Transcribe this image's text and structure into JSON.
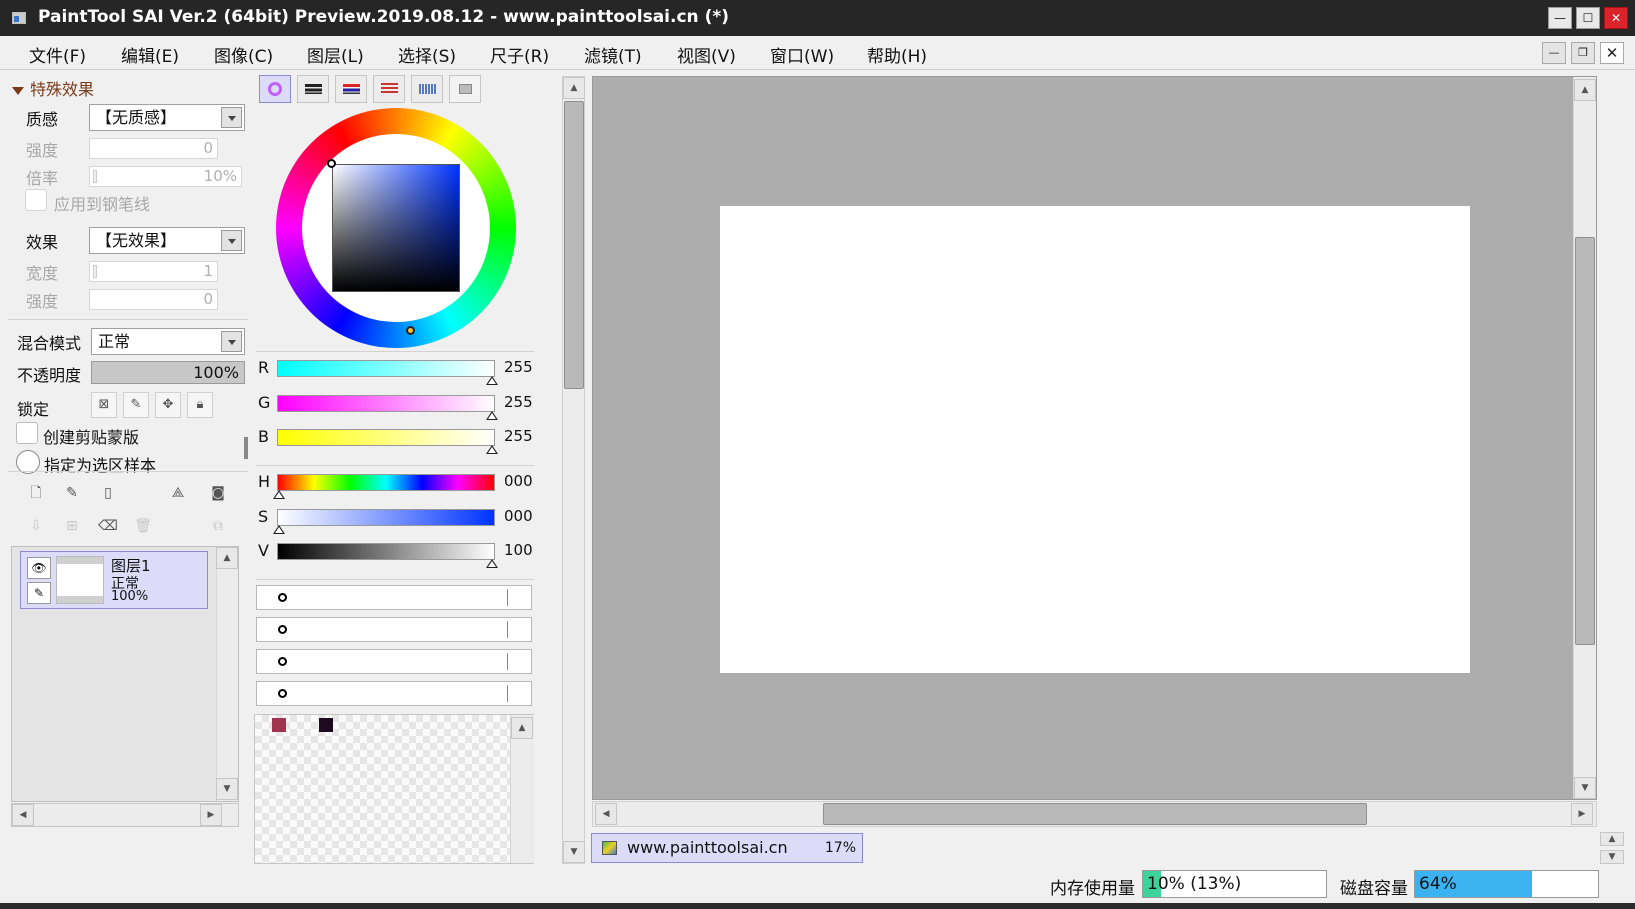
{
  "window": {
    "title": "PaintTool SAI Ver.2 (64bit) Preview.2019.08.12 - www.painttoolsai.cn (*)",
    "minimize": "—",
    "maximize": "☐",
    "close": "✕"
  },
  "menu": {
    "items": [
      "文件(F)",
      "编辑(E)",
      "图像(C)",
      "图层(L)",
      "选择(S)",
      "尺子(R)",
      "滤镜(T)",
      "视图(V)",
      "窗口(W)",
      "帮助(H)"
    ],
    "min": "—",
    "restore": "❐",
    "close": "✕"
  },
  "layer_props": {
    "section_title": "特殊效果",
    "texture_label": "质感",
    "texture_value": "【无质感】",
    "strength_label": "强度",
    "strength_value": "0",
    "rate_label": "倍率",
    "rate_value": "10%",
    "apply_pen_label": "应用到钢笔线",
    "effect_label": "效果",
    "effect_value": "【无效果】",
    "width_label": "宽度",
    "width_value": "1",
    "effect_strength_label": "强度",
    "effect_strength_value": "0",
    "blend_label": "混合模式",
    "blend_value": "正常",
    "opacity_label": "不透明度",
    "opacity_value": "100%",
    "opacity_fraction": 1.0,
    "lock_label": "锁定",
    "clip_label": "创建剪贴蒙版",
    "sample_label": "指定为选区样本"
  },
  "layers": [
    {
      "name": "图层1",
      "mode": "正常",
      "opacity": "100%"
    }
  ],
  "color": {
    "rgb": [
      {
        "label": "R",
        "value": "255",
        "from": "#00ffff",
        "to": "#ffffff"
      },
      {
        "label": "G",
        "value": "255",
        "from": "#ff00ff",
        "to": "#ffffff"
      },
      {
        "label": "B",
        "value": "255",
        "from": "#ffff00",
        "to": "#ffffff"
      }
    ],
    "hsv": [
      {
        "label": "H",
        "value": "000"
      },
      {
        "label": "S",
        "value": "000"
      },
      {
        "label": "V",
        "value": "100"
      }
    ],
    "swatches": [
      "#a0334f",
      "#1e0a1e"
    ]
  },
  "document": {
    "tab_name": "www.painttoolsai.cn",
    "zoom": "17%"
  },
  "status": {
    "memory_label": "内存使用量",
    "memory_value": "10% (13%)",
    "memory_fraction": 0.1,
    "memory_color": "#3ed39a",
    "disk_label": "磁盘容量",
    "disk_value": "64%",
    "disk_fraction": 0.64,
    "disk_color": "#3bb3f0"
  }
}
